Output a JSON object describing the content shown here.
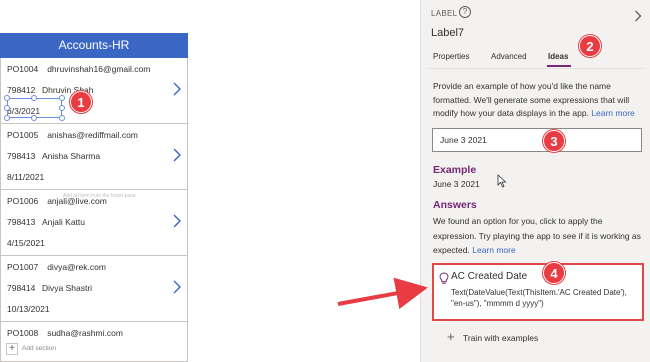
{
  "app": {
    "header": "Accounts-HR",
    "add_section": "Add section",
    "faint_tip": "Add an item from the Insert pane",
    "rows": [
      {
        "po": "PO1004",
        "email": "dhruvinshah16@gmail.com",
        "id": "798412",
        "name": "Dhruvin Shah",
        "date": "6/3/2021"
      },
      {
        "po": "PO1005",
        "email": "anishas@rediffmail.com",
        "id": "798413",
        "name": "Anisha Sharma",
        "date": "8/11/2021"
      },
      {
        "po": "PO1006",
        "email": "anjali@live.com",
        "id": "798413",
        "name": "Anjali Kattu",
        "date": "4/15/2021"
      },
      {
        "po": "PO1007",
        "email": "divya@rek.com",
        "id": "798414",
        "name": "Divya Shastri",
        "date": "10/13/2021"
      },
      {
        "po": "PO1008",
        "email": "sudha@rashmi.com"
      }
    ]
  },
  "panel": {
    "kind": "LABEL",
    "name": "Label7",
    "tabs": [
      "Properties",
      "Advanced",
      "Ideas"
    ],
    "intro": "Provide an example of how you'd like the name formatted. We'll generate some expressions that will modify how your data displays in the app.",
    "learn_more": "Learn more",
    "input_value": "June 3 2021",
    "example_title": "Example",
    "example_value": "June 3 2021",
    "answers_title": "Answers",
    "answers_desc": "We found an option for you, click to apply the expression. Try playing the app to see if it is working as expected.",
    "answers_learn_more": "Learn more",
    "answer": {
      "title": "AC Created Date",
      "expression": "Text(DateValue(Text(ThisItem.'AC Created Date'), \"en-us\"), \"mmmm d yyyy\")"
    },
    "train": "Train with examples"
  },
  "badges": [
    "1",
    "2",
    "3",
    "4"
  ],
  "colors": {
    "accent": "#742774",
    "header": "#3a67c3",
    "callout": "#e83b42"
  },
  "icons": [
    "chevron-right-icon",
    "help-icon",
    "lightbulb-icon",
    "plus-icon",
    "cursor-icon"
  ]
}
